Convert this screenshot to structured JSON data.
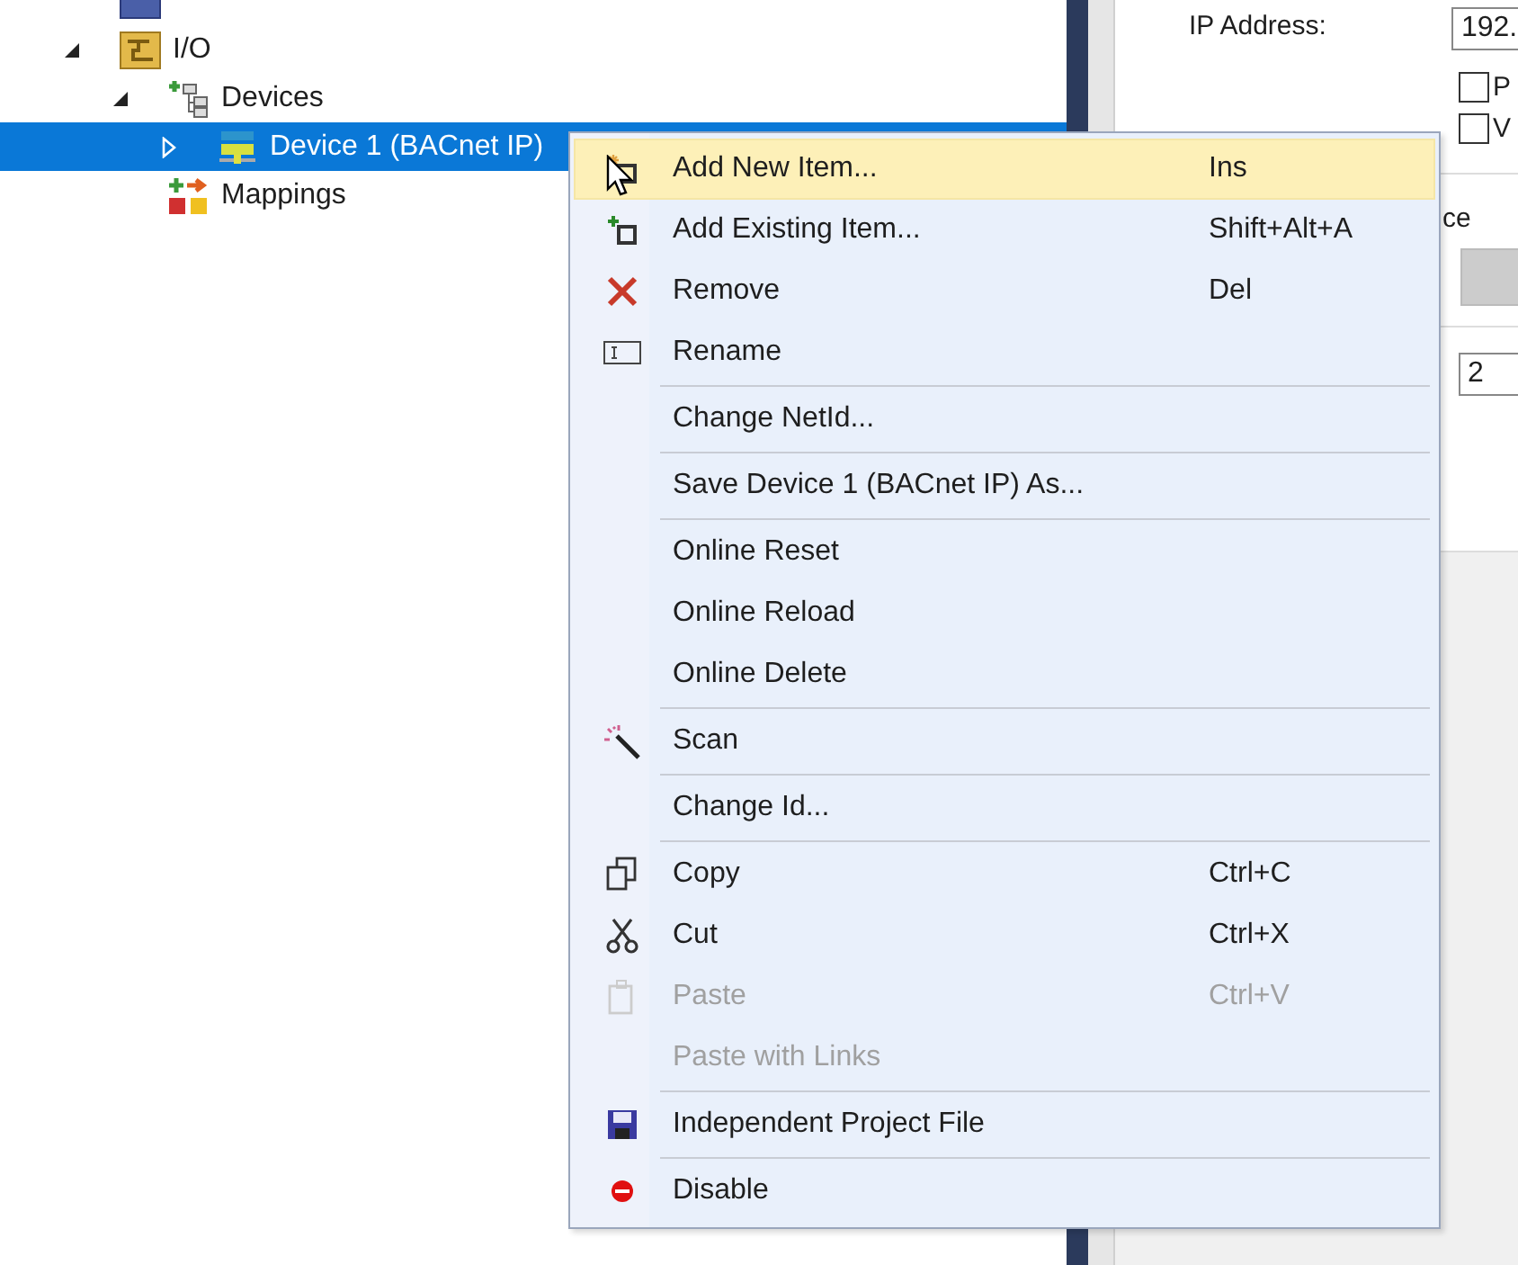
{
  "tree": [
    {
      "label": "I/O",
      "expanded": true,
      "children": [
        {
          "label": "Devices",
          "expanded": true,
          "children": [
            {
              "label": "Device 1 (BACnet IP)",
              "expanded": false,
              "selected": true
            }
          ]
        },
        {
          "label": "Mappings",
          "selected": false
        }
      ]
    }
  ],
  "properties": {
    "ip_label": "IP Address:",
    "ip_value": "192.",
    "checkboxes": [
      {
        "label": "P",
        "checked": false
      },
      {
        "label": "V",
        "checked": false
      }
    ],
    "section_label": "ce",
    "number_value": "2"
  },
  "context_menu": [
    {
      "kind": "item",
      "label": "Add New Item...",
      "shortcut": "Ins",
      "selected": true,
      "disabled": false
    },
    {
      "kind": "item",
      "label": "Add Existing Item...",
      "shortcut": "Shift+Alt+A",
      "selected": false,
      "disabled": false
    },
    {
      "kind": "item",
      "label": "Remove",
      "shortcut": "Del",
      "selected": false,
      "disabled": false
    },
    {
      "kind": "item",
      "label": "Rename",
      "selected": false,
      "disabled": false
    },
    {
      "kind": "separator"
    },
    {
      "kind": "item",
      "label": "Change NetId...",
      "selected": false,
      "disabled": false
    },
    {
      "kind": "separator"
    },
    {
      "kind": "item",
      "label": "Save Device 1 (BACnet IP) As...",
      "selected": false,
      "disabled": false
    },
    {
      "kind": "separator"
    },
    {
      "kind": "item",
      "label": "Online Reset",
      "selected": false,
      "disabled": false
    },
    {
      "kind": "item",
      "label": "Online Reload",
      "selected": false,
      "disabled": false
    },
    {
      "kind": "item",
      "label": "Online Delete",
      "selected": false,
      "disabled": false
    },
    {
      "kind": "separator"
    },
    {
      "kind": "item",
      "label": "Scan",
      "selected": false,
      "disabled": false
    },
    {
      "kind": "separator"
    },
    {
      "kind": "item",
      "label": "Change Id...",
      "selected": false,
      "disabled": false
    },
    {
      "kind": "separator"
    },
    {
      "kind": "item",
      "label": "Copy",
      "shortcut": "Ctrl+C",
      "selected": false,
      "disabled": false
    },
    {
      "kind": "item",
      "label": "Cut",
      "shortcut": "Ctrl+X",
      "selected": false,
      "disabled": false
    },
    {
      "kind": "item",
      "label": "Paste",
      "shortcut": "Ctrl+V",
      "selected": false,
      "disabled": true
    },
    {
      "kind": "item",
      "label": "Paste with Links",
      "selected": false,
      "disabled": true
    },
    {
      "kind": "separator"
    },
    {
      "kind": "item",
      "label": "Independent Project File",
      "selected": false,
      "disabled": false
    },
    {
      "kind": "separator"
    },
    {
      "kind": "item",
      "label": "Disable",
      "selected": false,
      "disabled": false
    }
  ]
}
